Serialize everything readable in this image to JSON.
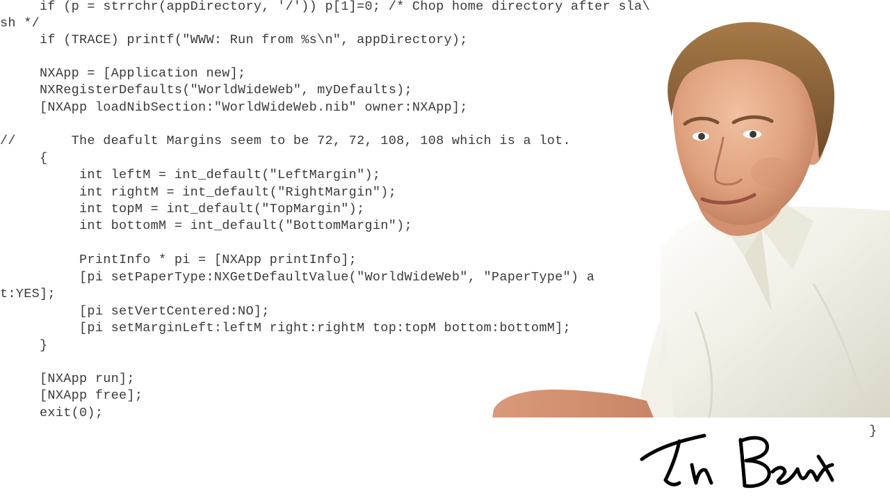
{
  "code": {
    "lines": [
      "     if (p = strrchr(appDirectory, '/')) p[1]=0; /* Chop home directory after sla\\",
      "sh */",
      "     if (TRACE) printf(\"WWW: Run from %s\\n\", appDirectory);",
      "",
      "     NXApp = [Application new];",
      "     NXRegisterDefaults(\"WorldWideWeb\", myDefaults);",
      "     [NXApp loadNibSection:\"WorldWideWeb.nib\" owner:NXApp];",
      "",
      "//       The deafult Margins seem to be 72, 72, 108, 108 which is a lot.",
      "     {",
      "          int leftM = int_default(\"LeftMargin\");",
      "          int rightM = int_default(\"RightMargin\");",
      "          int topM = int_default(\"TopMargin\");",
      "          int bottomM = int_default(\"BottomMargin\");",
      "",
      "          PrintInfo * pi = [NXApp printInfo];",
      "          [pi setPaperType:NXGetDefaultValue(\"WorldWideWeb\", \"PaperType\") a",
      "t:YES];",
      "          [pi setVertCentered:NO];",
      "          [pi setMarginLeft:leftM right:rightM top:topM bottom:bottomM];",
      "     }",
      "",
      "     [NXApp run];",
      "     [NXApp free];",
      "     exit(0);"
    ],
    "closing_brace": "}"
  },
  "signature": {
    "text": "Tim Berners-Lee"
  },
  "colors": {
    "code_text": "#3a3a3a",
    "background": "#ffffff",
    "shirt": "#f4f3ec",
    "skin": "#e2a889",
    "hair": "#8a6238"
  }
}
